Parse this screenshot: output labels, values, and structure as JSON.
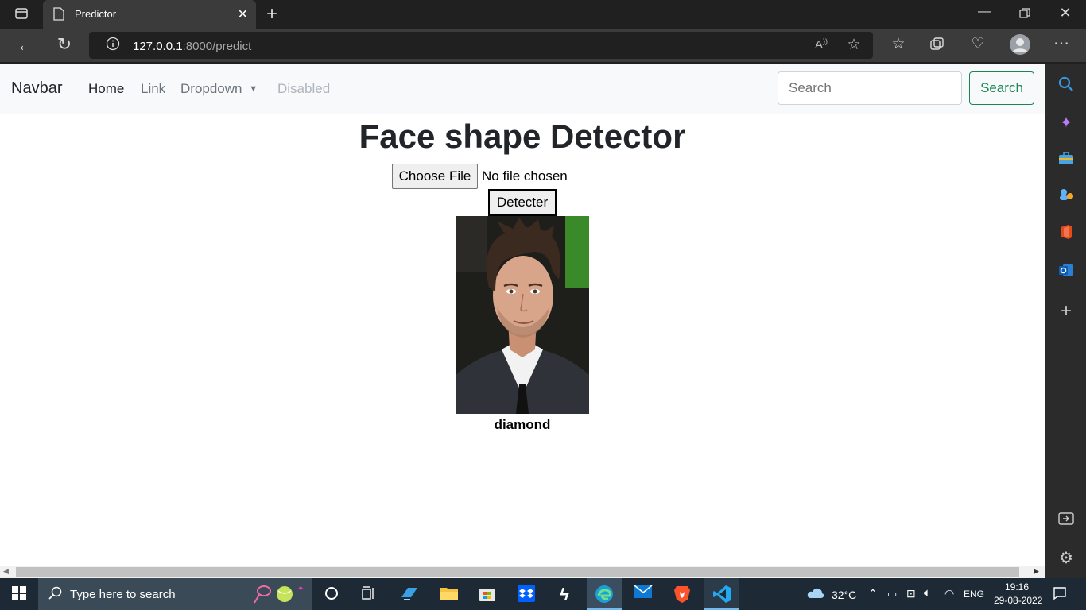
{
  "browser": {
    "tab_title": "Predictor",
    "url_host": "127.0.0.1",
    "url_rest": ":8000/predict"
  },
  "navbar": {
    "brand": "Navbar",
    "links": [
      "Home",
      "Link",
      "Dropdown",
      "Disabled"
    ],
    "search_placeholder": "Search",
    "search_button": "Search"
  },
  "main": {
    "title": "Face shape Detector",
    "choose_file": "Choose File",
    "no_file": "No file chosen",
    "detect_button": "Detecter",
    "result": "diamond"
  },
  "taskbar": {
    "search_placeholder": "Type here to search",
    "temperature": "32°C",
    "language": "ENG",
    "time": "19:16",
    "date": "29-08-2022"
  },
  "colors": {
    "success": "#198754",
    "navbar_bg": "#f8f9fa",
    "edge_accent": "#0078d4"
  }
}
